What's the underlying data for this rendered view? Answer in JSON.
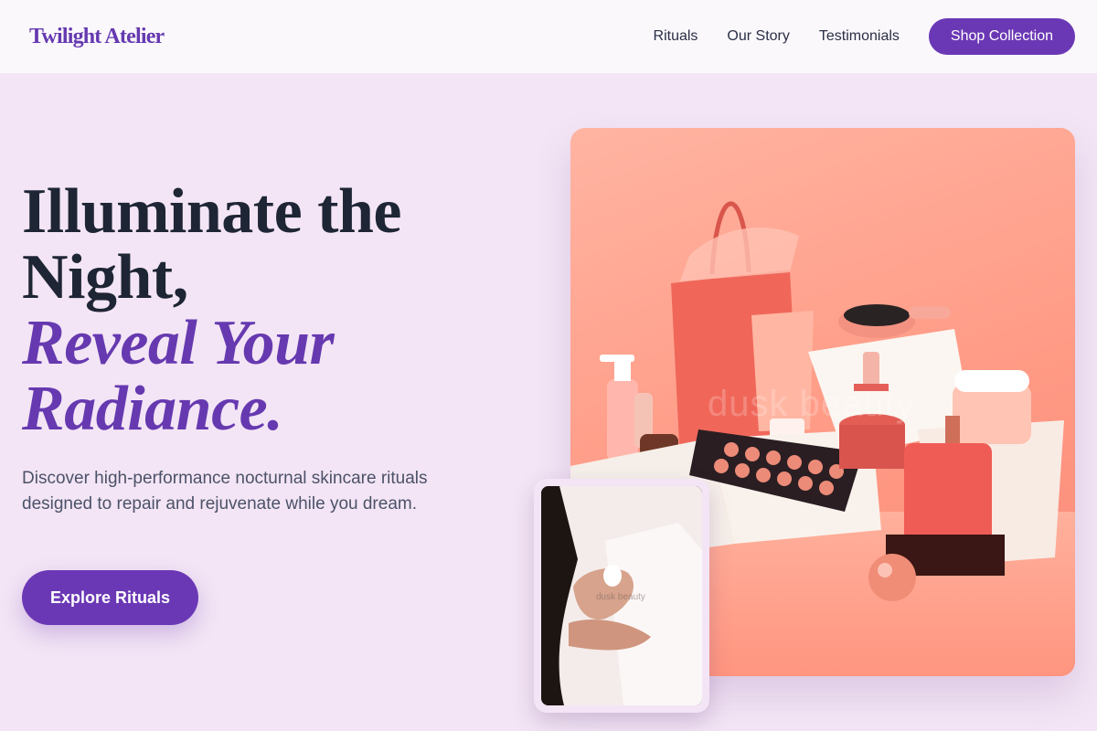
{
  "header": {
    "logo": "Twilight Atelier",
    "nav": [
      "Rituals",
      "Our Story",
      "Testimonials"
    ],
    "cta": "Shop Collection"
  },
  "hero": {
    "title_line1": "Illuminate the Night,",
    "title_line2": "Reveal Your Radiance.",
    "description": "Discover high-performance nocturnal skincare rituals designed to repair and rejuvenate while you dream.",
    "button": "Explore Rituals"
  },
  "images": {
    "main_watermark": "dusk beauty",
    "inset_watermark": "dusk beauty"
  },
  "colors": {
    "accent": "#6b38b5",
    "background": "#f3e5f5",
    "header_bg": "#fbf8fc",
    "text_dark": "#1e2535",
    "product_coral": "#ff9a85"
  }
}
